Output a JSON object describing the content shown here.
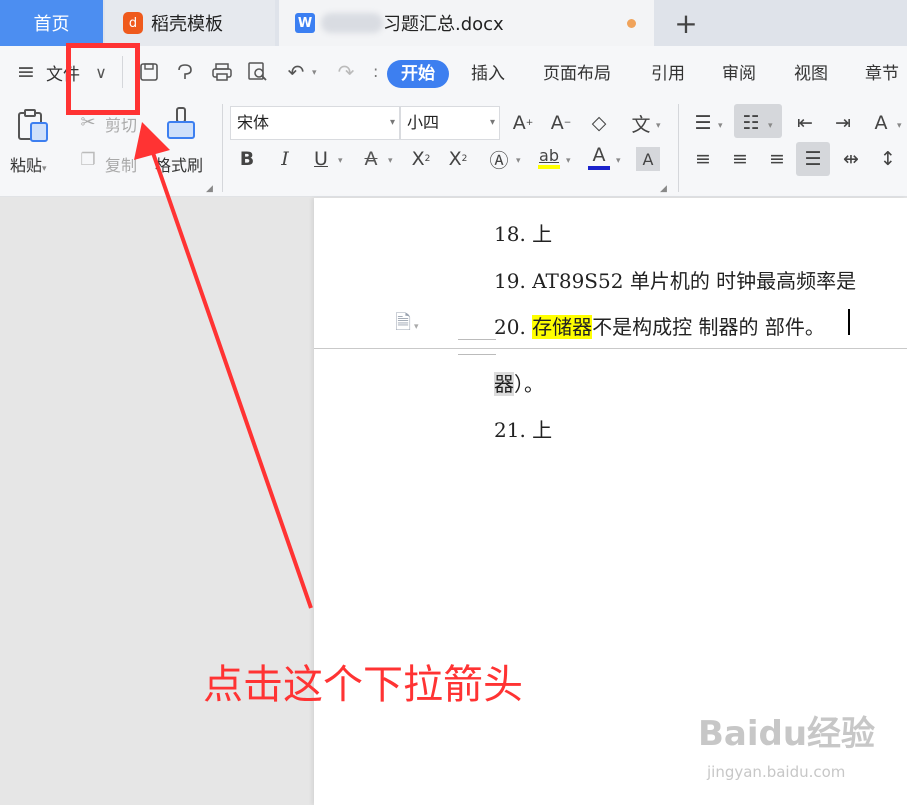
{
  "tabs": {
    "home": "首页",
    "daoke": "稻壳模板",
    "daoke_logo": "d",
    "doc_logo": "W",
    "doc": "习题汇总.docx",
    "new": "+"
  },
  "toolbar": {
    "file_label": "文件",
    "ribbon_tabs": [
      "开始",
      "插入",
      "页面布局",
      "引用",
      "审阅",
      "视图",
      "章节"
    ],
    "paste": "粘贴",
    "cut": "剪切",
    "copy": "复制",
    "format_painter": "格式刷",
    "font_name": "宋体",
    "font_size": "小四",
    "phonetic_glyph": "文"
  },
  "document": {
    "lines": [
      {
        "num": "18.",
        "text": "上"
      },
      {
        "num": "19.",
        "text": "AT89S52 单片机的    时钟最高频率是"
      },
      {
        "num": "20.",
        "highlight": "存储器",
        "text": "不是构成控 制器的    部件。"
      },
      {
        "num": "",
        "grey": "器",
        "text": "）。"
      },
      {
        "num": "21.",
        "text": "上"
      }
    ]
  },
  "annotation": {
    "instruction": "点击这个下拉箭头",
    "color": "#ff3333"
  },
  "watermark": {
    "brand": "Baidu经验",
    "url": "jingyan.baidu.com"
  },
  "colors": {
    "accent": "#3d7ff0",
    "highlight": "#ffff00"
  }
}
